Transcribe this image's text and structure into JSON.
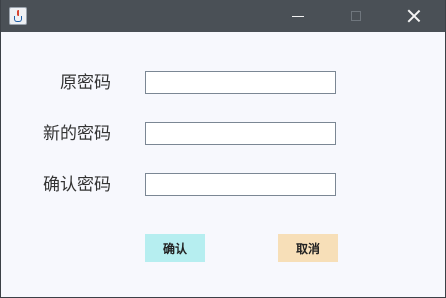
{
  "window": {
    "title": "",
    "controls": {
      "minimize": "minimize",
      "maximize": "maximize",
      "close": "close"
    },
    "colors": {
      "titlebar": "#4a5056",
      "background": "#f7f8fd"
    }
  },
  "form": {
    "fields": [
      {
        "label": "原密码",
        "value": ""
      },
      {
        "label": "新的密码",
        "value": ""
      },
      {
        "label": "确认密码",
        "value": ""
      }
    ]
  },
  "buttons": {
    "confirm_label": "确认",
    "cancel_label": "取消",
    "confirm_color": "#b6eef0",
    "cancel_color": "#f7dfb8"
  },
  "icons": {
    "app": "java-cup-icon",
    "minimize": "minimize-icon",
    "maximize": "maximize-icon",
    "close": "close-icon"
  }
}
